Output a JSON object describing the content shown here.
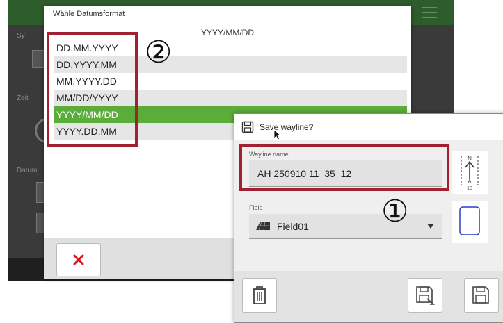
{
  "date_dialog": {
    "title": "Wähle Datumsformat",
    "current_format": "YYYY/MM/DD",
    "formats": [
      "DD.MM.YYYY",
      "DD.YYYY.MM",
      "MM.YYYY.DD",
      "MM/DD/YYYY",
      "YYYY/MM/DD",
      "YYYY.DD.MM"
    ],
    "selected_index": 4,
    "cancel_icon": "close-icon"
  },
  "background": {
    "items": [
      "Sy",
      "Zeit",
      "Datum"
    ]
  },
  "save_dialog": {
    "title": "Save wayline?",
    "wayline_label": "Wayline name",
    "wayline_value": "AH 250910 11_35_12",
    "field_label": "Field",
    "field_value": "Field01",
    "compass_number": "10"
  },
  "callouts": [
    "①",
    "②"
  ],
  "colors": {
    "highlight": "#a0212f",
    "selected": "#5aad39",
    "topbar": "#2c5d2a"
  }
}
